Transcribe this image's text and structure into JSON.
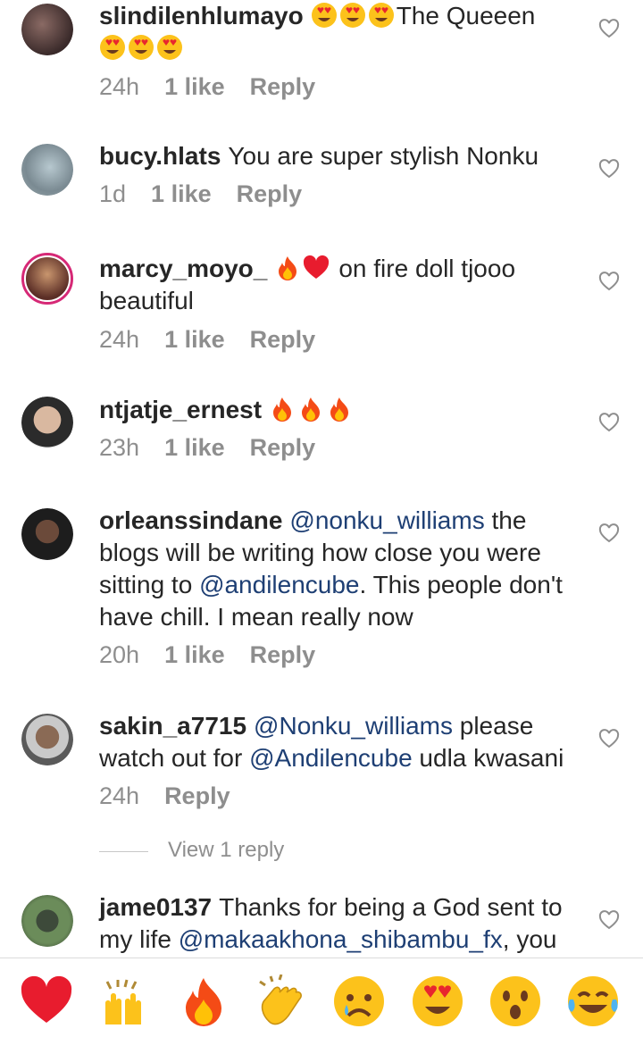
{
  "comments": [
    {
      "username": "slindilenhlumayo",
      "text": "The Queeen",
      "time": "24h",
      "likes": "1 like",
      "reply": "Reply"
    },
    {
      "username": "bucy.hlats",
      "text": "You are super stylish Nonku",
      "time": "1d",
      "likes": "1 like",
      "reply": "Reply"
    },
    {
      "username": "marcy_moyo_",
      "text_a": "on fire doll tjooo",
      "text_b": "beautiful",
      "time": "24h",
      "likes": "1 like",
      "reply": "Reply"
    },
    {
      "username": "ntjatje_ernest",
      "time": "23h",
      "likes": "1 like",
      "reply": "Reply"
    },
    {
      "username": "orleanssindane",
      "mention1": "@nonku_williams",
      "text_a": " the blogs will be writing how close you were sitting to ",
      "mention2": "@andilencube",
      "text_b": ". This people don't have chill. I mean really now",
      "time": "20h",
      "likes": "1 like",
      "reply": "Reply"
    },
    {
      "username": "sakin_a7715",
      "mention1": "@Nonku_williams",
      "text_a": " please watch out for ",
      "mention2": "@Andilencube",
      "text_b": " udla kwasani",
      "time": "24h",
      "reply": "Reply",
      "view_replies": "View 1 reply"
    },
    {
      "username": "jame0137",
      "text_a": "Thanks for being a God sent to my life ",
      "mention1": "@makaakhona_shibambu_fx",
      "text_b": ",  you"
    }
  ],
  "reactions": [
    "red-heart",
    "raising-hands",
    "fire",
    "clapping-hands",
    "sad-face",
    "heart-eyes",
    "surprised-face",
    "tears-of-joy"
  ],
  "colors": {
    "mention": "#1e3f74",
    "meta": "#8e8e8e",
    "username": "#262626"
  }
}
